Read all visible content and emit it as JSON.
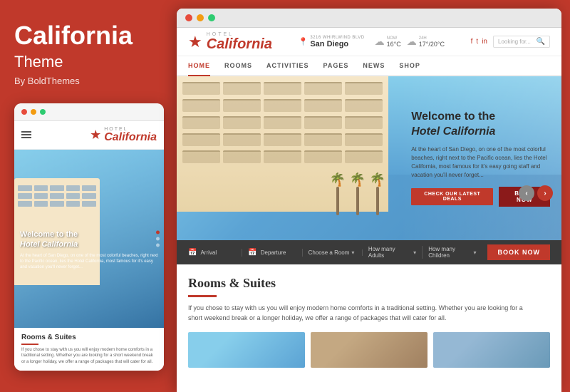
{
  "sidebar": {
    "title": "California",
    "subtitle": "Theme",
    "author": "By BoldThemes",
    "mobile_preview": {
      "dots": [
        "red",
        "yellow",
        "green"
      ],
      "hotel_label": "HOTEL",
      "california_text": "California",
      "hero_heading_line1": "Welcome to the",
      "hero_heading_line2": "Hotel California",
      "hero_desc": "At the heart of San Diego, on one of the most colorful beaches, right next to the Pacific ocean, lies the Hotel California, most famous for it's easy and vacation you'll never forget...",
      "rooms_title": "Rooms & Suites",
      "rooms_underline": true,
      "rooms_desc": "If you chose to stay with us you will enjoy modern home comforts in a traditional setting. Whether you are looking for a short weekend break or a longer holiday, we offer a range of packages that will cater for all."
    }
  },
  "browser": {
    "dots": [
      "red",
      "yellow",
      "green"
    ]
  },
  "website": {
    "header": {
      "hotel_label": "HOTEL",
      "california_text": "California",
      "address_street": "3216 WHIRLWIND BLVD",
      "address_city": "San Diego",
      "weather_now_label": "NOW",
      "weather_temp1": "16°C",
      "weather_time": "24H",
      "weather_temp2": "17°/20°C",
      "search_placeholder": "Looking for...",
      "social": [
        "f",
        "t",
        "in"
      ]
    },
    "nav": {
      "items": [
        "HOME",
        "ROOMS",
        "ACTIVITIES",
        "PAGES",
        "NEWS",
        "SHOP"
      ],
      "active": "HOME"
    },
    "hero": {
      "heading_line1": "Welcome to the",
      "heading_line2": "Hotel California",
      "description": "At the heart of San Diego, on one of the most colorful beaches, right next to the Pacific ocean, lies the Hotel California, most famous for it's easy going staff and vacation you'll never forget...",
      "btn_check_label": "CHECK OUR LATEST DEALS",
      "btn_book_label": "BOOK NOW"
    },
    "booking_bar": {
      "arrival_label": "Arrival",
      "departure_label": "Departure",
      "room_label": "Choose a Room",
      "adults_label": "How many Adults",
      "children_label": "How many Children",
      "book_label": "BOOK NOW"
    },
    "rooms_section": {
      "title": "Rooms & Suites",
      "description": "If you chose to stay with us you will enjoy modern home comforts in a traditional setting. Whether you are looking for a short weekend break or a longer holiday, we offer a range of packages that will cater for all."
    }
  }
}
